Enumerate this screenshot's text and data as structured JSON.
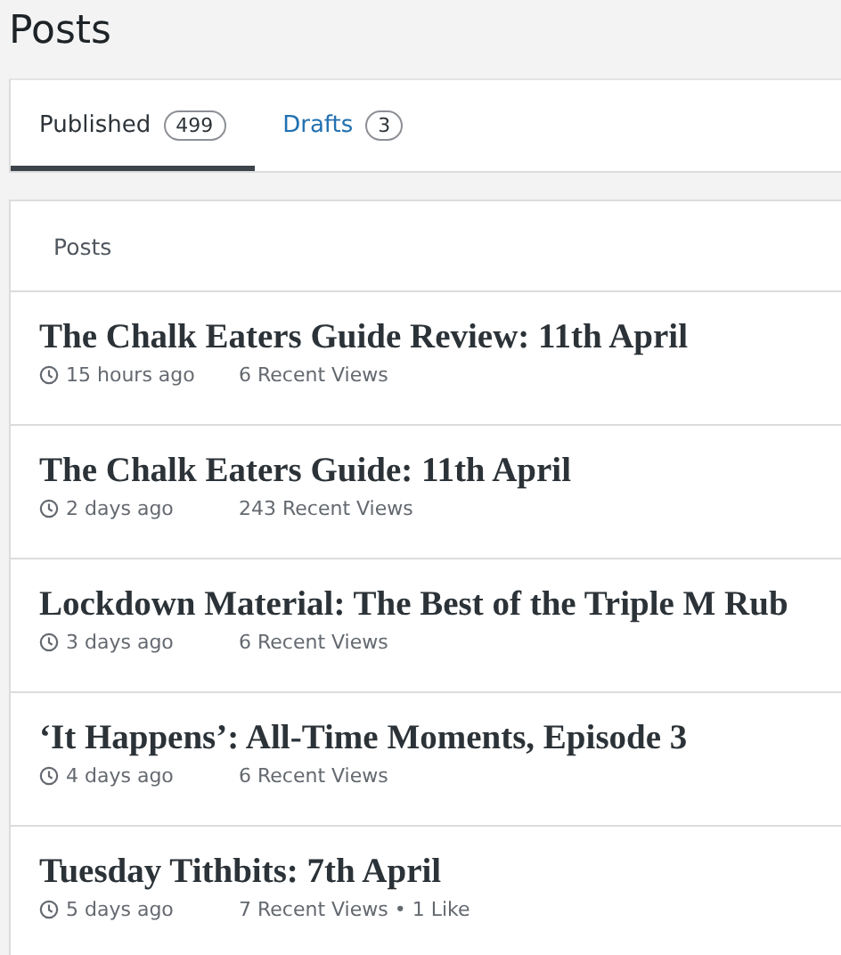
{
  "page_title": "Posts",
  "tabs": [
    {
      "label": "Published",
      "count": "499",
      "selected": true
    },
    {
      "label": "Drafts",
      "count": "3",
      "selected": false
    }
  ],
  "list": {
    "header": "Posts",
    "posts": [
      {
        "title": "The Chalk Eaters Guide Review: 11th April",
        "age": "15 hours ago",
        "stats": "6 Recent Views"
      },
      {
        "title": "The Chalk Eaters Guide: 11th April",
        "age": "2 days ago",
        "stats": "243 Recent Views"
      },
      {
        "title": "Lockdown Material: The Best of the Triple M Rub",
        "age": "3 days ago",
        "stats": "6 Recent Views"
      },
      {
        "title": "‘It Happens’: All-Time Moments, Episode 3",
        "age": "4 days ago",
        "stats": "6 Recent Views"
      },
      {
        "title": "Tuesday Tithbits: 7th April",
        "age": "5 days ago",
        "stats": "7 Recent Views • 1 Like"
      }
    ]
  }
}
